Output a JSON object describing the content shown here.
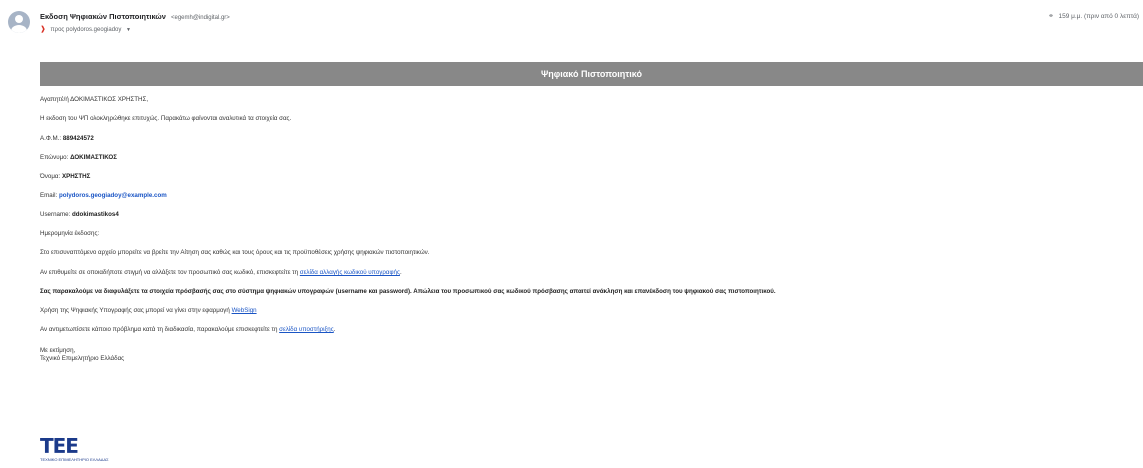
{
  "header": {
    "sender_name": "Εκδοση Ψηφιακών Πιστοποιητικών",
    "sender_email": "<egemh@indigital.gr>",
    "to_prefix": "προς",
    "recipient": "polydoros.geogiadoy",
    "time": "159 μ.μ. (πριν από 0 λεπτά)",
    "important_icon": "important-marker-icon",
    "attachment_icon": "paperclip-icon"
  },
  "banner": {
    "title": "Ψηφιακό Πιστοποιητικό",
    "color": "#888888"
  },
  "body": {
    "greeting": "Αγαπητέ/ή ΔΟΚΙΜΑΣΤΙΚΟΣ ΧΡΗΣΤΗΣ,",
    "intro": "Η εκδοση του ΨΠ ολοκληρώθηκε επιτυχώς. Παρακάτω φαίνονται αναλυτικά τα στοιχεία σας.",
    "afm_label": "Α.Φ.Μ.:",
    "afm_value": "889424572",
    "surname_label": "Επώνυμο:",
    "surname_value": "ΔΟΚΙΜΑΣΤΙΚΟΣ",
    "name_label": "Όνομα:",
    "name_value": "ΧΡΗΣΤΗΣ",
    "email_label": "Email:",
    "email_value": "polydoros.geogiadoy@example.com",
    "username_label": "Username:",
    "username_value": "ddokimastikos4",
    "issue_date_label": "Ημερομηνία έκδοσης:",
    "attachment_note": "Στο επισυναπτόμενο αρχείο μπορείτε να βρείτε την Αίτηση σας καθώς και τους όρους και τις προϋποθέσεις χρήσης ψηφιακών πιστοποιητικών.",
    "password_text": "Αν επιθυμείτε σε οποιαδήποτε στιγμή να αλλάξετε τον προσωπικό σας κωδικό, επισκεφτείτε τη",
    "password_link": "σελίδα αλλαγής κωδικού υπογραφής",
    "warning": "Σας παρακαλούμε να διαφυλάξετε τα στοιχεία πρόσβασής σας στο σύστημα ψηφιακών υπογραφών (username και password). Απώλεια του προσωπικού σας κωδικού πρόσβασης απαιτεί ανάκληση και επανέκδοση του ψηφιακού σας πιστοποιητικού.",
    "websign_text": "Χρήση της Ψηφιακής Υπογραφής σας μπορεί να γίνει στην εφαρμογή",
    "websign_link": "WebSign",
    "support_text": "Αν αντιμετωπίσετε κάποιο πρόβλημα κατά τη διαδικασία, παρακαλούμε επισκεφτείτε τη",
    "support_link": "σελίδα υποστήριξης",
    "closing": "Με εκτίμηση,",
    "org": "Τεχνικό Επιμελητήριο Ελλάδας"
  },
  "logo": {
    "mark": "ΤΕΕ",
    "subtitle": "ΤΕΧΝΙΚΟ ΕΠΙΜΕΛΗΤΗΡΙΟ ΕΛΛΑΔΑΣ"
  }
}
